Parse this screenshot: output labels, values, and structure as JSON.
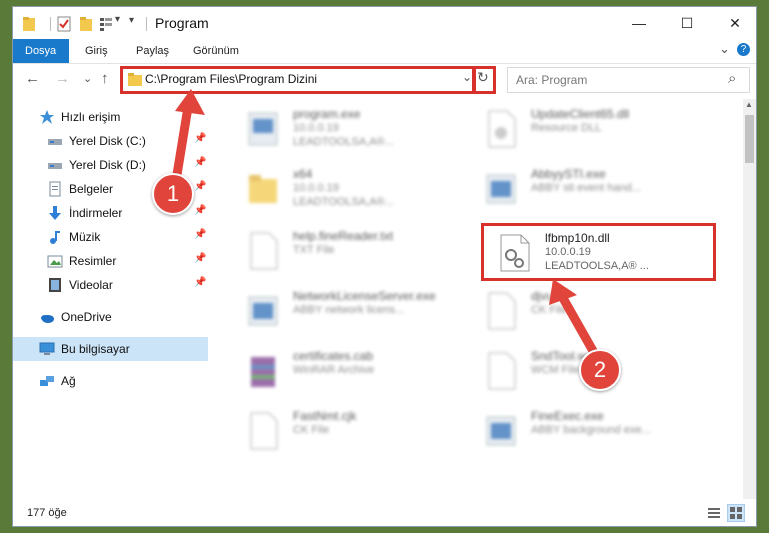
{
  "window": {
    "title": "Program",
    "minimize": "—",
    "maximize": "☐",
    "close": "✕"
  },
  "ribbon": {
    "tabs": [
      {
        "label": "Dosya",
        "active": true
      },
      {
        "label": "Giriş"
      },
      {
        "label": "Paylaş"
      },
      {
        "label": "Görünüm"
      }
    ],
    "expand": "⌄",
    "help": "?"
  },
  "nav": {
    "back": "←",
    "forward": "→",
    "recent": "⌄",
    "up": "↑"
  },
  "address": {
    "path": "C:\\Program Files\\Program Dizini",
    "dropdown": "⌄",
    "refresh": "↻"
  },
  "search": {
    "placeholder": "Ara: Program",
    "icon": "⌕"
  },
  "sidebar": {
    "items": [
      {
        "label": "Hızlı erişim"
      },
      {
        "label": "Yerel Disk (C:)",
        "pin": "📌"
      },
      {
        "label": "Yerel Disk (D:)",
        "pin": "📌"
      },
      {
        "label": "Belgeler",
        "pin": "📌"
      },
      {
        "label": "İndirmeler",
        "pin": "📌"
      },
      {
        "label": "Müzik",
        "pin": "📌"
      },
      {
        "label": "Resimler",
        "pin": "📌"
      },
      {
        "label": "Videolar",
        "pin": "📌"
      },
      {
        "label": "OneDrive"
      },
      {
        "label": "Bu bilgisayar"
      },
      {
        "label": "Ağ"
      }
    ]
  },
  "files": [
    {
      "name": "program.exe",
      "line1": "10.0.0.19",
      "line2": "LEADTOOLSA,A®..."
    },
    {
      "name": "UpdateClient65.dll",
      "line1": "Resource DLL"
    },
    {
      "name": "AbbyySTI.exe",
      "line1": "ABBY sti event hand..."
    },
    {
      "name": "x64",
      "line1": "10.0.0.19",
      "line2": "LEADTOOLSA,A®..."
    },
    {
      "name": "help.fineReader.txt",
      "line1": "TXT File"
    },
    {
      "name": "lfbmp10n.dll",
      "line1": "10.0.0.19",
      "line2": "LEADTOOLSA,A® ..."
    },
    {
      "name": "NetworkLicenseServer.exe",
      "line1": "ABBY network licens..."
    },
    {
      "name": "djvus",
      "line1": "CK File"
    },
    {
      "name": "certificates.cab",
      "line1": "WinRAR Archive"
    },
    {
      "name": "SndTool.wcm",
      "line1": "WCM File"
    },
    {
      "name": "FastNmt.cjk",
      "line1": "CK File"
    },
    {
      "name": "FineExec.exe",
      "line1": "ABBY background exe..."
    }
  ],
  "status": {
    "count": "177 öğe"
  },
  "markers": [
    "1",
    "2"
  ],
  "colors": {
    "accent": "#1979ca",
    "highlight": "#d6322b",
    "selected": "#cce4f7"
  }
}
